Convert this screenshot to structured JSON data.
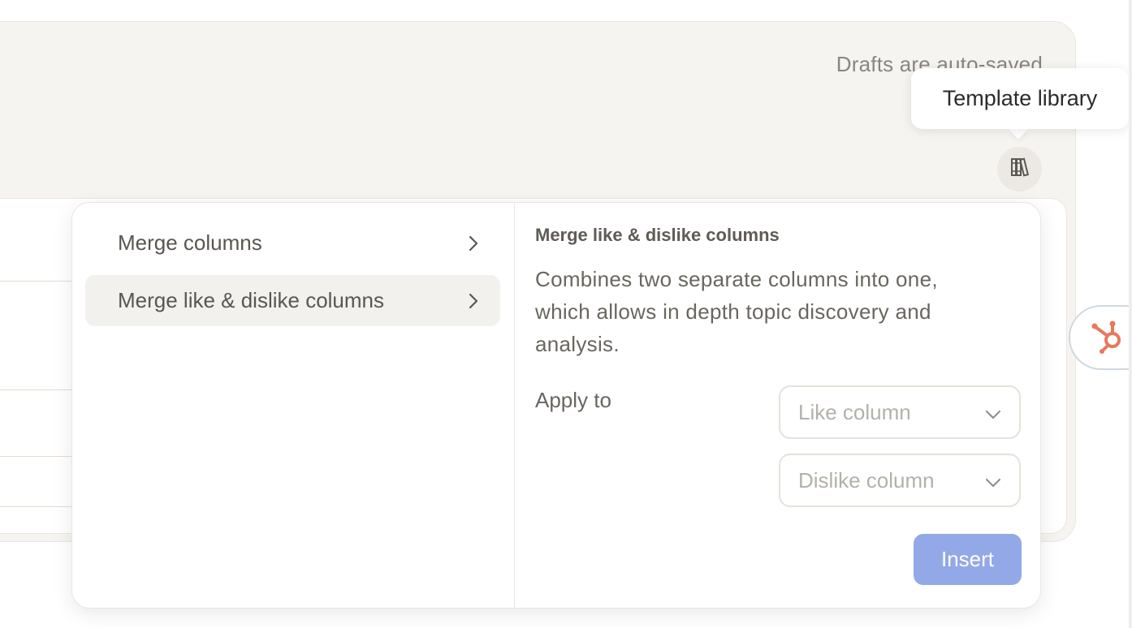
{
  "editor": {
    "drafts_note": "Drafts are auto-saved"
  },
  "toolbar": {
    "library_icon": "books-icon",
    "tooltip": "Template library"
  },
  "menu": {
    "items": [
      {
        "label": "Merge columns",
        "icon": "chevron-right-icon",
        "active": false
      },
      {
        "label": "Merge like & dislike columns",
        "icon": "chevron-right-icon",
        "active": true
      }
    ]
  },
  "detail": {
    "title": "Merge like & dislike columns",
    "description": "Combines two separate columns into one, which allows in depth topic discovery and analysis.",
    "apply_label": "Apply to",
    "like_select": {
      "placeholder": "Like column",
      "icon": "chevron-down-icon"
    },
    "dislike_select": {
      "placeholder": "Dislike column",
      "icon": "chevron-down-icon"
    },
    "insert_label": "Insert"
  },
  "widgets": {
    "hubspot_icon": "hubspot-sprocket-icon"
  },
  "colors": {
    "panel_bg": "#f6f4f1",
    "insert_button": "#93a8e6",
    "hubspot_accent": "#e8795b",
    "active_item_bg": "#f3f1ee"
  }
}
